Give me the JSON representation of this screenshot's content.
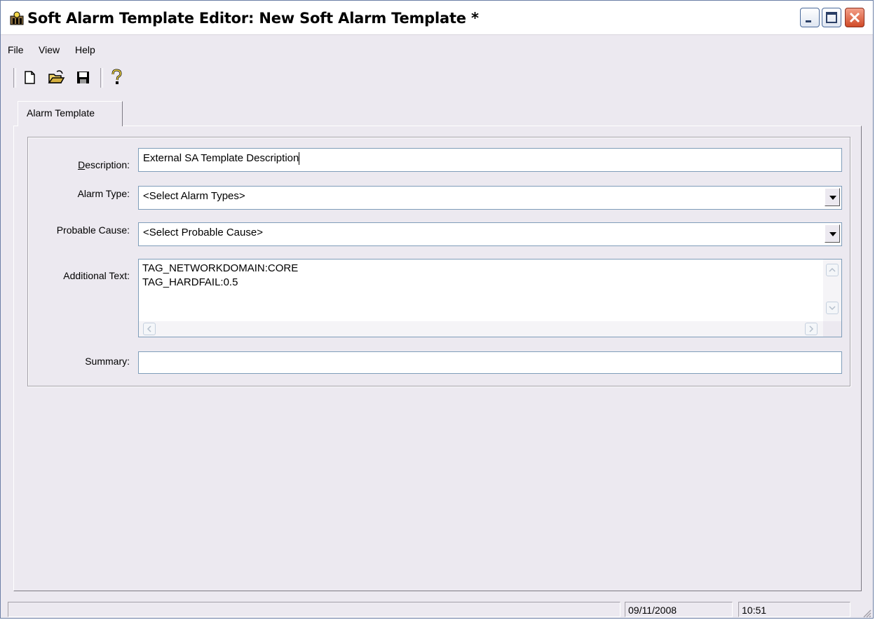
{
  "window": {
    "title": "Soft Alarm Template Editor: New Soft Alarm Template *"
  },
  "menu": {
    "items": [
      "File",
      "View",
      "Help"
    ]
  },
  "toolbar": {
    "icons": [
      "new-document-icon",
      "open-folder-icon",
      "save-icon",
      "help-icon"
    ]
  },
  "tabs": [
    {
      "label": "Alarm Template"
    }
  ],
  "form": {
    "description": {
      "label": "Description:",
      "value": "External SA Template Description"
    },
    "alarm_type": {
      "label": "Alarm Type:",
      "value": "<Select Alarm Types>"
    },
    "probable_cause": {
      "label": "Probable Cause:",
      "value": "<Select Probable Cause>"
    },
    "additional_text": {
      "label": "Additional Text:",
      "value": "TAG_NETWORKDOMAIN:CORE\nTAG_HARDFAIL:0.5"
    },
    "summary": {
      "label": "Summary:",
      "value": ""
    }
  },
  "status": {
    "main": "",
    "date": "09/11/2008",
    "time": "10:51"
  },
  "colors": {
    "window_bg": "#ece9f0",
    "close_button": "#d04a27",
    "field_border": "#7f9db9"
  }
}
